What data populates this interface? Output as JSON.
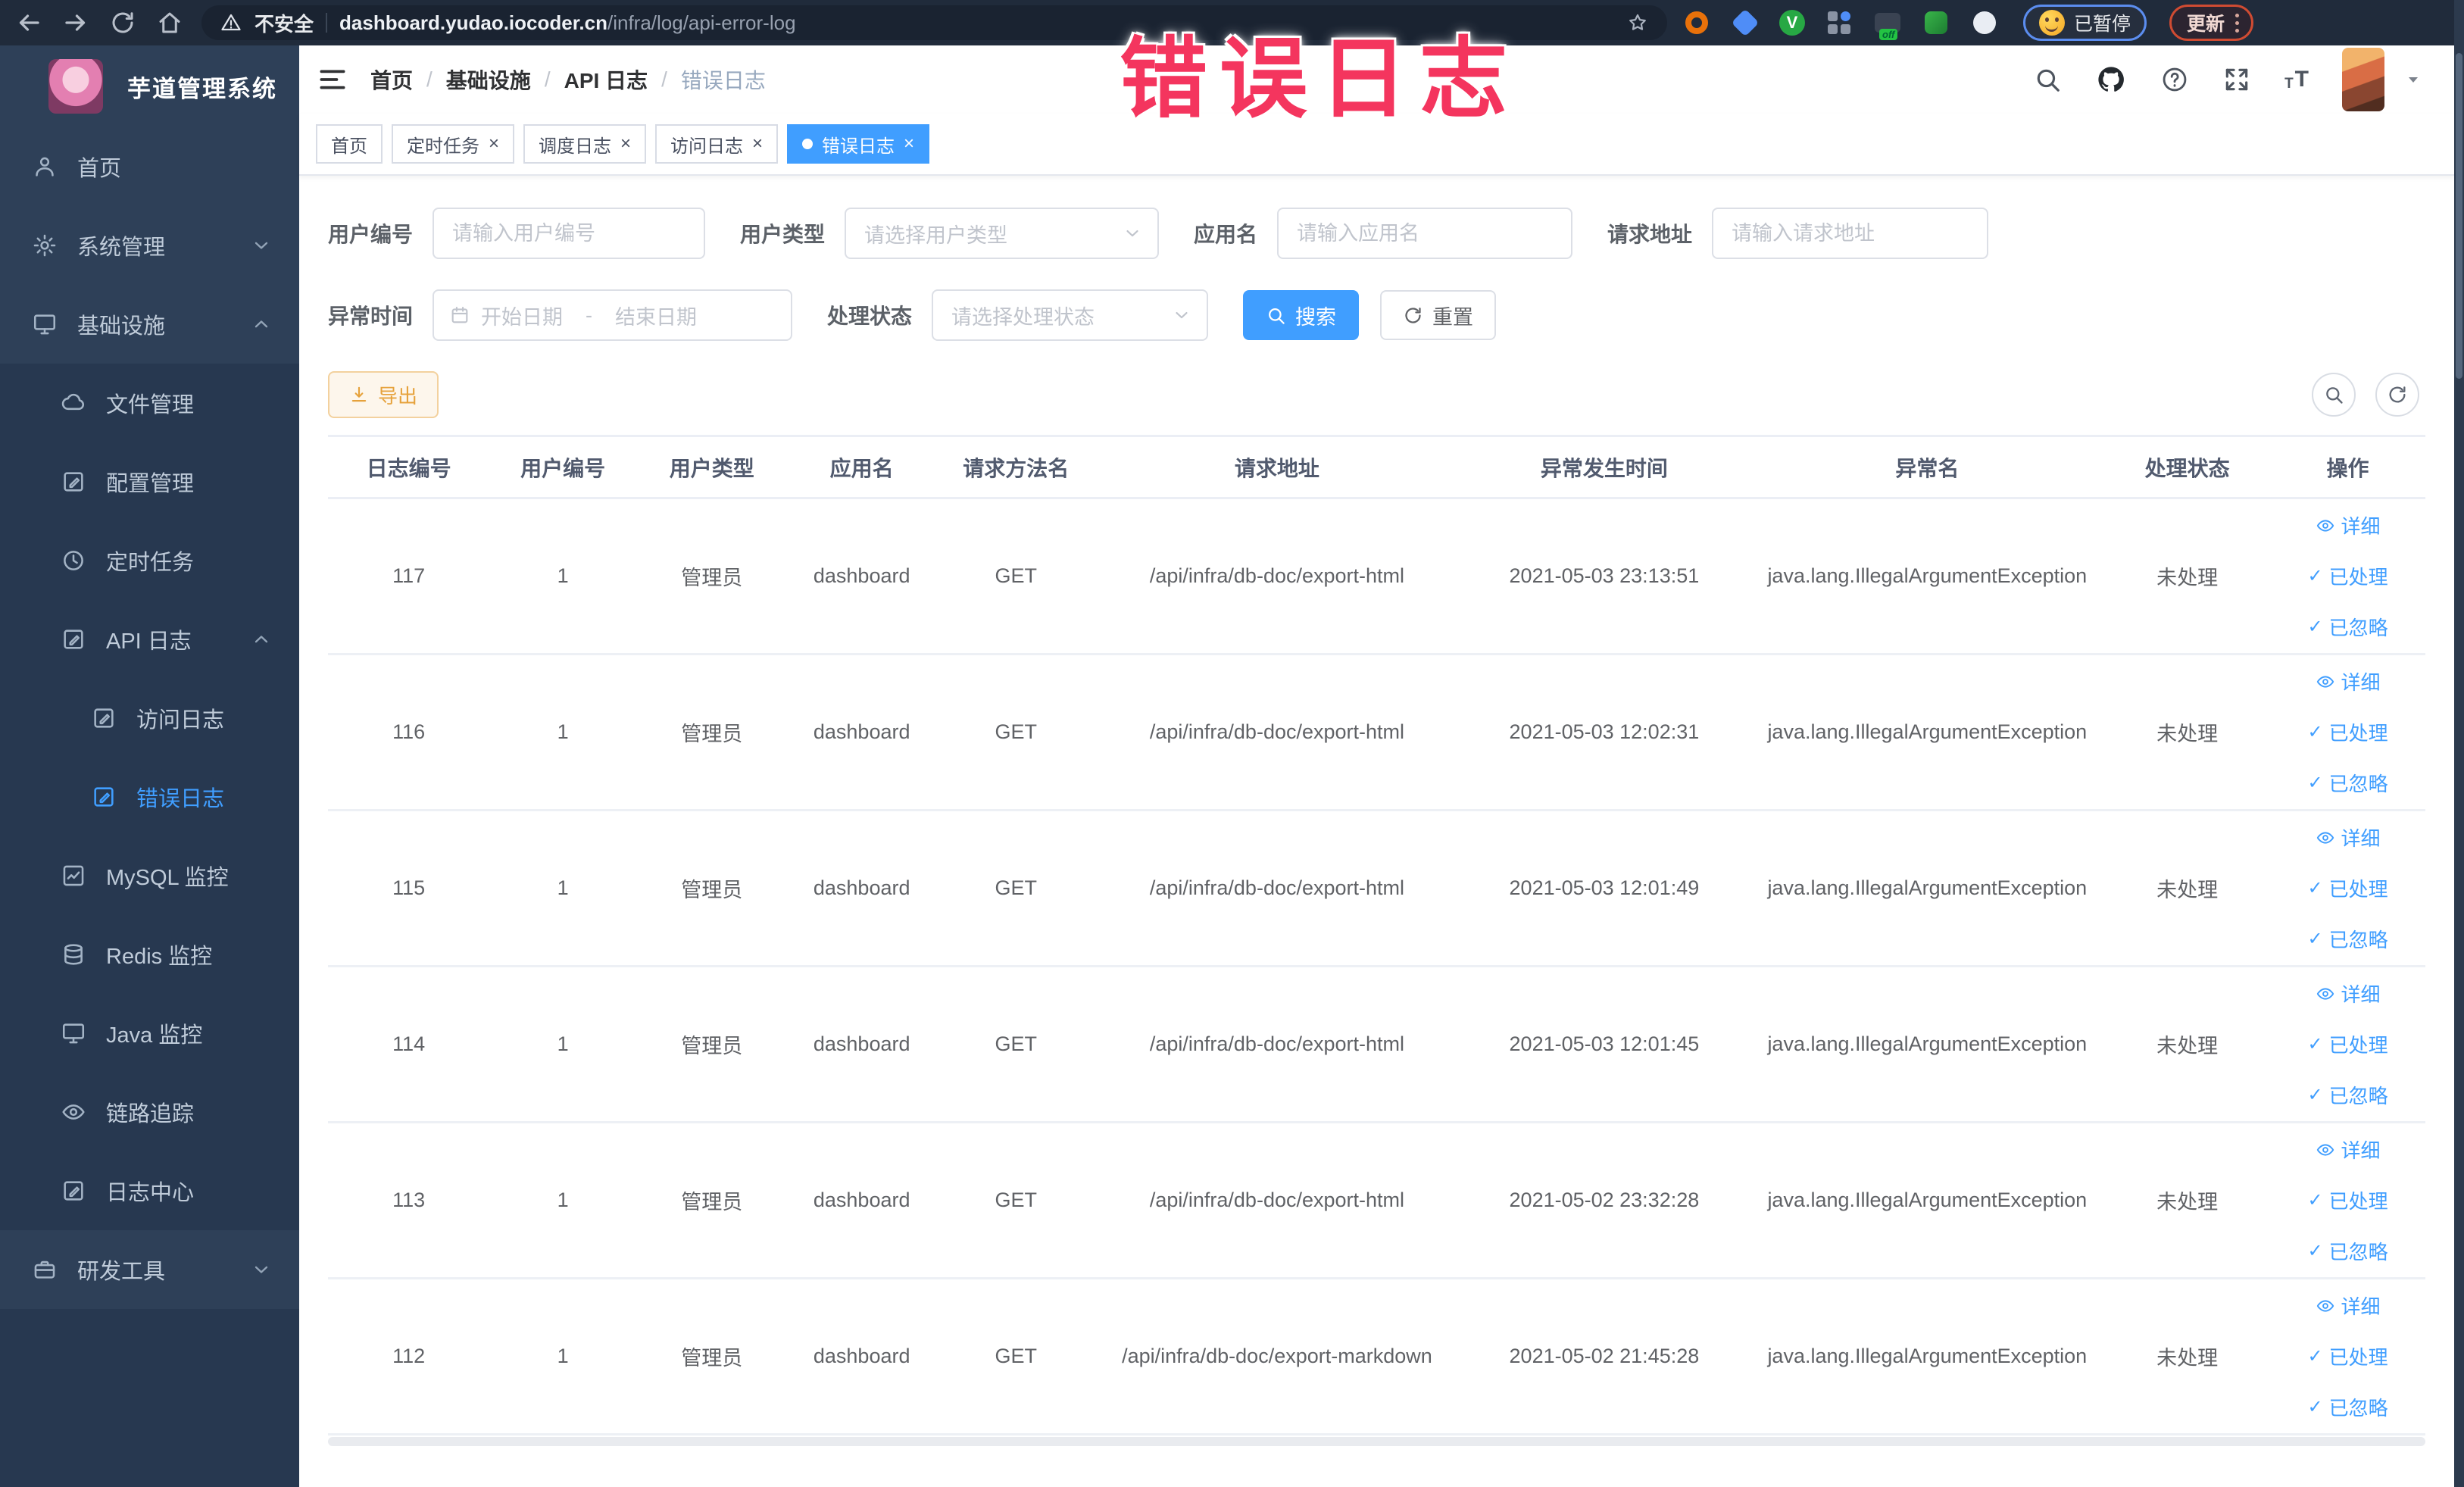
{
  "browser": {
    "security_label": "不安全",
    "url_domain": "dashboard.yudao.iocoder.cn",
    "url_path": "/infra/log/api-error-log",
    "paused_badge": "已暂停",
    "update_button": "更新"
  },
  "overlay": {
    "text": "错误日志",
    "color": "#f4355e"
  },
  "sidebar": {
    "title": "芋道管理系统",
    "items": [
      {
        "label": "首页"
      },
      {
        "label": "系统管理"
      },
      {
        "label": "基础设施"
      },
      {
        "label": "文件管理"
      },
      {
        "label": "配置管理"
      },
      {
        "label": "定时任务"
      },
      {
        "label": "API 日志"
      },
      {
        "label": "访问日志"
      },
      {
        "label": "错误日志"
      },
      {
        "label": "MySQL 监控"
      },
      {
        "label": "Redis 监控"
      },
      {
        "label": "Java 监控"
      },
      {
        "label": "链路追踪"
      },
      {
        "label": "日志中心"
      },
      {
        "label": "研发工具"
      }
    ]
  },
  "breadcrumb": {
    "separator": "/",
    "items": [
      "首页",
      "基础设施",
      "API 日志",
      "错误日志"
    ]
  },
  "tabs": [
    {
      "label": "首页"
    },
    {
      "label": "定时任务"
    },
    {
      "label": "调度日志"
    },
    {
      "label": "访问日志"
    },
    {
      "label": "错误日志"
    }
  ],
  "filters": {
    "user_id": {
      "label": "用户编号",
      "placeholder": "请输入用户编号"
    },
    "user_type": {
      "label": "用户类型",
      "placeholder": "请选择用户类型"
    },
    "app_name": {
      "label": "应用名",
      "placeholder": "请输入应用名"
    },
    "request_url": {
      "label": "请求地址",
      "placeholder": "请输入请求地址"
    },
    "exception_time": {
      "label": "异常时间",
      "start_placeholder": "开始日期",
      "separator": "-",
      "end_placeholder": "结束日期"
    },
    "process_status": {
      "label": "处理状态",
      "placeholder": "请选择处理状态"
    },
    "search_button": "搜索",
    "reset_button": "重置"
  },
  "toolbar": {
    "export_button": "导出"
  },
  "table": {
    "columns": [
      "日志编号",
      "用户编号",
      "用户类型",
      "应用名",
      "请求方法名",
      "请求地址",
      "异常发生时间",
      "异常名",
      "处理状态",
      "操作"
    ],
    "actions": {
      "detail": "详细",
      "processed": "已处理",
      "ignored": "已忽略"
    },
    "rows": [
      {
        "id": "117",
        "user_id": "1",
        "user_type": "管理员",
        "app": "dashboard",
        "method": "GET",
        "url": "/api/infra/db-doc/export-html",
        "time": "2021-05-03 23:13:51",
        "exception": "java.lang.IllegalArgumentException",
        "status": "未处理"
      },
      {
        "id": "116",
        "user_id": "1",
        "user_type": "管理员",
        "app": "dashboard",
        "method": "GET",
        "url": "/api/infra/db-doc/export-html",
        "time": "2021-05-03 12:02:31",
        "exception": "java.lang.IllegalArgumentException",
        "status": "未处理"
      },
      {
        "id": "115",
        "user_id": "1",
        "user_type": "管理员",
        "app": "dashboard",
        "method": "GET",
        "url": "/api/infra/db-doc/export-html",
        "time": "2021-05-03 12:01:49",
        "exception": "java.lang.IllegalArgumentException",
        "status": "未处理"
      },
      {
        "id": "114",
        "user_id": "1",
        "user_type": "管理员",
        "app": "dashboard",
        "method": "GET",
        "url": "/api/infra/db-doc/export-html",
        "time": "2021-05-03 12:01:45",
        "exception": "java.lang.IllegalArgumentException",
        "status": "未处理"
      },
      {
        "id": "113",
        "user_id": "1",
        "user_type": "管理员",
        "app": "dashboard",
        "method": "GET",
        "url": "/api/infra/db-doc/export-html",
        "time": "2021-05-02 23:32:28",
        "exception": "java.lang.IllegalArgumentException",
        "status": "未处理"
      },
      {
        "id": "112",
        "user_id": "1",
        "user_type": "管理员",
        "app": "dashboard",
        "method": "GET",
        "url": "/api/infra/db-doc/export-markdown",
        "time": "2021-05-02 21:45:28",
        "exception": "java.lang.IllegalArgumentException",
        "status": "未处理"
      }
    ]
  },
  "colors": {
    "accent": "#409eff",
    "warning": "#e6a23c",
    "annotation": "#f4355e",
    "sidebar_bg": "#2e4058"
  }
}
